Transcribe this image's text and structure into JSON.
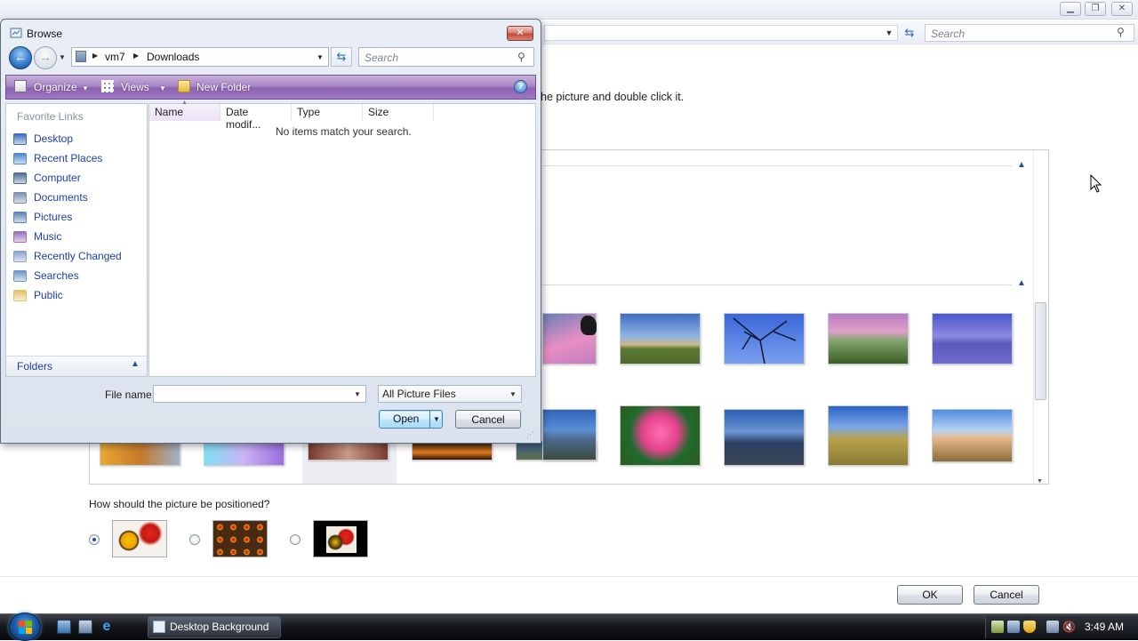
{
  "background_window": {
    "address_value": "",
    "search_placeholder": "Search",
    "instructions": "he picture and double click it.",
    "position_question": "How should the picture be positioned?",
    "position_options": [
      "fit",
      "tile",
      "center"
    ],
    "position_selected": "fit",
    "ok_label": "OK",
    "cancel_label": "Cancel"
  },
  "dialog": {
    "title": "Browse",
    "breadcrumbs": [
      "vm7",
      "Downloads"
    ],
    "search_placeholder": "Search",
    "toolbar": {
      "organize": "Organize",
      "views": "Views",
      "new_folder": "New Folder"
    },
    "favorite_links_title": "Favorite Links",
    "favorite_links": [
      {
        "label": "Desktop",
        "icon": "desktop-icon",
        "color": "#3a6fb8"
      },
      {
        "label": "Recent Places",
        "icon": "recent-places-icon",
        "color": "#4f88c9"
      },
      {
        "label": "Computer",
        "icon": "computer-icon",
        "color": "#4a6e96"
      },
      {
        "label": "Documents",
        "icon": "documents-icon",
        "color": "#7a8fb0"
      },
      {
        "label": "Pictures",
        "icon": "pictures-icon",
        "color": "#5d84b8"
      },
      {
        "label": "Music",
        "icon": "music-icon",
        "color": "#9a6fb8"
      },
      {
        "label": "Recently Changed",
        "icon": "recently-changed-icon",
        "color": "#8aa3c9"
      },
      {
        "label": "Searches",
        "icon": "searches-icon",
        "color": "#6c97c8"
      },
      {
        "label": "Public",
        "icon": "public-folder-icon",
        "color": "#e3c266"
      }
    ],
    "folders_label": "Folders",
    "columns": [
      "Name",
      "Date modif...",
      "Type",
      "Size"
    ],
    "empty_message": "No items match your search.",
    "file_name_label": "File name:",
    "file_name_value": "",
    "file_type_value": "All Picture Files",
    "open_label": "Open",
    "cancel_label": "Cancel"
  },
  "taskbar": {
    "task_button": "Desktop Background",
    "clock": "3:49 AM"
  }
}
